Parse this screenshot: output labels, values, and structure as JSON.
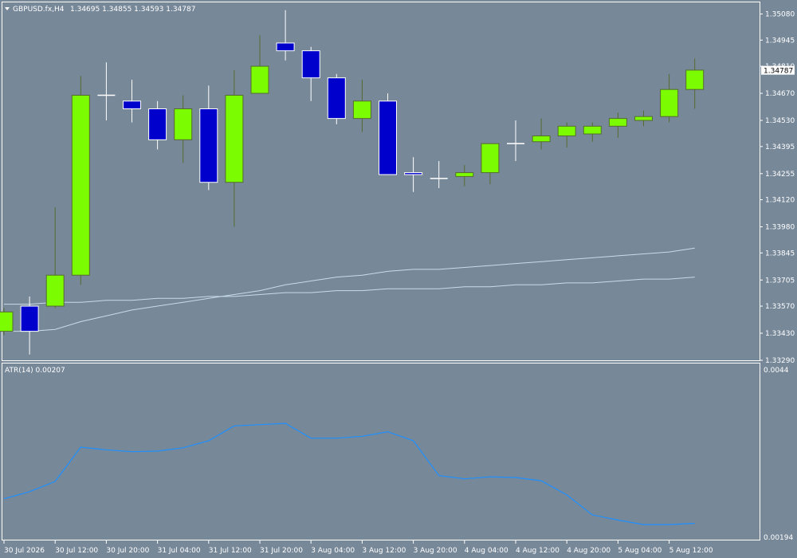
{
  "header": {
    "symbol": "GBPUSD.fx,H4",
    "ohlc": "1.34695 1.34855 1.34593 1.34787"
  },
  "indicator": {
    "label": "ATR(14) 0.00207",
    "scale_top": "0.0044",
    "scale_bottom": "0.00194"
  },
  "colors": {
    "background": "#778899",
    "grid_frame": "#ffffff",
    "bull_candle": "#7cfc00",
    "bear_candle": "#0000cd",
    "ma_lines": "#c8dce8",
    "atr_line": "#1e90ff",
    "text": "#ffffff"
  },
  "chart_data": [
    {
      "type": "candlestick",
      "symbol": "GBPUSD.fx",
      "timeframe": "H4",
      "ylim": [
        1.3329,
        1.3514
      ],
      "y_ticks": [
        "1.35080",
        "1.34945",
        "1.34810",
        "1.34670",
        "1.34530",
        "1.34395",
        "1.34255",
        "1.34120",
        "1.33980",
        "1.33845",
        "1.33705",
        "1.33570",
        "1.33430",
        "1.33290"
      ],
      "current_price": "1.34787",
      "x_ticks": [
        "30 Jul 2026",
        "30 Jul 12:00",
        "30 Jul 20:00",
        "31 Jul 04:00",
        "31 Jul 12:00",
        "31 Jul 20:00",
        "3 Aug 04:00",
        "3 Aug 12:00",
        "3 Aug 20:00",
        "4 Aug 04:00",
        "4 Aug 12:00",
        "4 Aug 20:00",
        "5 Aug 04:00",
        "5 Aug 12:00"
      ],
      "candles": [
        {
          "o": 1.3344,
          "h": 1.3356,
          "l": 1.3342,
          "c": 1.3354
        },
        {
          "o": 1.3357,
          "h": 1.3362,
          "l": 1.3332,
          "c": 1.3344
        },
        {
          "o": 1.3357,
          "h": 1.3408,
          "l": 1.3356,
          "c": 1.3373
        },
        {
          "o": 1.3373,
          "h": 1.3476,
          "l": 1.3368,
          "c": 1.3466
        },
        {
          "o": 1.3466,
          "h": 1.3483,
          "l": 1.3453,
          "c": 1.3466
        },
        {
          "o": 1.3463,
          "h": 1.3474,
          "l": 1.3452,
          "c": 1.3459
        },
        {
          "o": 1.3459,
          "h": 1.3463,
          "l": 1.3438,
          "c": 1.3443
        },
        {
          "o": 1.3443,
          "h": 1.3466,
          "l": 1.3431,
          "c": 1.3459
        },
        {
          "o": 1.3459,
          "h": 1.3471,
          "l": 1.3417,
          "c": 1.3421
        },
        {
          "o": 1.3421,
          "h": 1.3479,
          "l": 1.3398,
          "c": 1.3466
        },
        {
          "o": 1.3467,
          "h": 1.3497,
          "l": 1.3467,
          "c": 1.3481
        },
        {
          "o": 1.3493,
          "h": 1.351,
          "l": 1.3484,
          "c": 1.3489
        },
        {
          "o": 1.3489,
          "h": 1.3491,
          "l": 1.3463,
          "c": 1.3475
        },
        {
          "o": 1.3475,
          "h": 1.3477,
          "l": 1.3451,
          "c": 1.3454
        },
        {
          "o": 1.3454,
          "h": 1.3474,
          "l": 1.3447,
          "c": 1.3463
        },
        {
          "o": 1.3463,
          "h": 1.3467,
          "l": 1.3425,
          "c": 1.3425
        },
        {
          "o": 1.3426,
          "h": 1.3434,
          "l": 1.3416,
          "c": 1.3425
        },
        {
          "o": 1.3423,
          "h": 1.3432,
          "l": 1.3418,
          "c": 1.3423
        },
        {
          "o": 1.3424,
          "h": 1.343,
          "l": 1.3419,
          "c": 1.3426
        },
        {
          "o": 1.3426,
          "h": 1.3441,
          "l": 1.342,
          "c": 1.3441
        },
        {
          "o": 1.3441,
          "h": 1.3453,
          "l": 1.3432,
          "c": 1.3441
        },
        {
          "o": 1.3442,
          "h": 1.3454,
          "l": 1.3438,
          "c": 1.3445
        },
        {
          "o": 1.3445,
          "h": 1.3452,
          "l": 1.3439,
          "c": 1.345
        },
        {
          "o": 1.3446,
          "h": 1.3452,
          "l": 1.3442,
          "c": 1.345
        },
        {
          "o": 1.345,
          "h": 1.3457,
          "l": 1.3444,
          "c": 1.3454
        },
        {
          "o": 1.3453,
          "h": 1.3458,
          "l": 1.345,
          "c": 1.3455
        },
        {
          "o": 1.3455,
          "h": 1.3477,
          "l": 1.3452,
          "c": 1.3469
        },
        {
          "o": 1.3469,
          "h": 1.3485,
          "l": 1.3459,
          "c": 1.3479
        }
      ],
      "ma_series": [
        {
          "values": [
            1.3344,
            1.3344,
            1.3345,
            1.3349,
            1.3352,
            1.3355,
            1.3357,
            1.3359,
            1.3361,
            1.3363,
            1.3365,
            1.3368,
            1.337,
            1.3372,
            1.3373,
            1.3375,
            1.3376,
            1.3376,
            1.3377,
            1.3378,
            1.3379,
            1.338,
            1.3381,
            1.3382,
            1.3383,
            1.3384,
            1.3385,
            1.3387
          ]
        },
        {
          "values": [
            1.3358,
            1.3358,
            1.3359,
            1.3359,
            1.336,
            1.336,
            1.3361,
            1.3361,
            1.3362,
            1.3362,
            1.3363,
            1.3364,
            1.3364,
            1.3365,
            1.3365,
            1.3366,
            1.3366,
            1.3366,
            1.3367,
            1.3367,
            1.3368,
            1.3368,
            1.3369,
            1.3369,
            1.337,
            1.3371,
            1.3371,
            1.3372
          ]
        }
      ]
    },
    {
      "type": "line",
      "name": "ATR(14)",
      "ylim": [
        0.00194,
        0.0044
      ],
      "y_ticks": [
        "0.0044",
        "0.00194"
      ],
      "values": [
        0.00245,
        0.00256,
        0.00272,
        0.00325,
        0.00321,
        0.00318,
        0.00319,
        0.00324,
        0.00335,
        0.00358,
        0.0036,
        0.00362,
        0.00339,
        0.00339,
        0.00342,
        0.00349,
        0.00335,
        0.00281,
        0.00276,
        0.00279,
        0.00278,
        0.00273,
        0.00251,
        0.0022,
        0.00212,
        0.00205,
        0.00205,
        0.00207
      ]
    }
  ]
}
